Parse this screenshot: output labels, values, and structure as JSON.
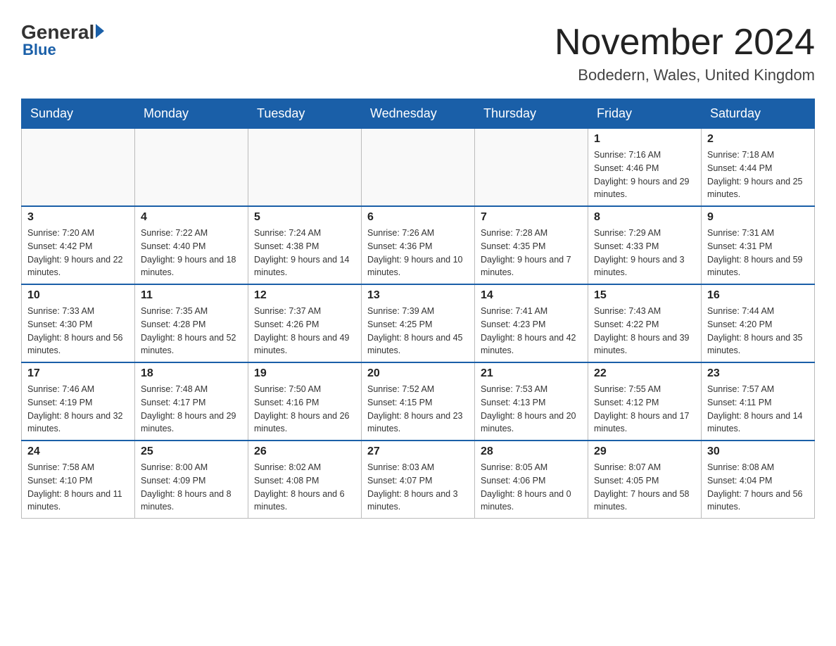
{
  "header": {
    "logo_general": "General",
    "logo_blue": "Blue",
    "title": "November 2024",
    "location": "Bodedern, Wales, United Kingdom"
  },
  "days_of_week": [
    "Sunday",
    "Monday",
    "Tuesday",
    "Wednesday",
    "Thursday",
    "Friday",
    "Saturday"
  ],
  "weeks": [
    [
      {
        "day": "",
        "info": ""
      },
      {
        "day": "",
        "info": ""
      },
      {
        "day": "",
        "info": ""
      },
      {
        "day": "",
        "info": ""
      },
      {
        "day": "",
        "info": ""
      },
      {
        "day": "1",
        "info": "Sunrise: 7:16 AM\nSunset: 4:46 PM\nDaylight: 9 hours and 29 minutes."
      },
      {
        "day": "2",
        "info": "Sunrise: 7:18 AM\nSunset: 4:44 PM\nDaylight: 9 hours and 25 minutes."
      }
    ],
    [
      {
        "day": "3",
        "info": "Sunrise: 7:20 AM\nSunset: 4:42 PM\nDaylight: 9 hours and 22 minutes."
      },
      {
        "day": "4",
        "info": "Sunrise: 7:22 AM\nSunset: 4:40 PM\nDaylight: 9 hours and 18 minutes."
      },
      {
        "day": "5",
        "info": "Sunrise: 7:24 AM\nSunset: 4:38 PM\nDaylight: 9 hours and 14 minutes."
      },
      {
        "day": "6",
        "info": "Sunrise: 7:26 AM\nSunset: 4:36 PM\nDaylight: 9 hours and 10 minutes."
      },
      {
        "day": "7",
        "info": "Sunrise: 7:28 AM\nSunset: 4:35 PM\nDaylight: 9 hours and 7 minutes."
      },
      {
        "day": "8",
        "info": "Sunrise: 7:29 AM\nSunset: 4:33 PM\nDaylight: 9 hours and 3 minutes."
      },
      {
        "day": "9",
        "info": "Sunrise: 7:31 AM\nSunset: 4:31 PM\nDaylight: 8 hours and 59 minutes."
      }
    ],
    [
      {
        "day": "10",
        "info": "Sunrise: 7:33 AM\nSunset: 4:30 PM\nDaylight: 8 hours and 56 minutes."
      },
      {
        "day": "11",
        "info": "Sunrise: 7:35 AM\nSunset: 4:28 PM\nDaylight: 8 hours and 52 minutes."
      },
      {
        "day": "12",
        "info": "Sunrise: 7:37 AM\nSunset: 4:26 PM\nDaylight: 8 hours and 49 minutes."
      },
      {
        "day": "13",
        "info": "Sunrise: 7:39 AM\nSunset: 4:25 PM\nDaylight: 8 hours and 45 minutes."
      },
      {
        "day": "14",
        "info": "Sunrise: 7:41 AM\nSunset: 4:23 PM\nDaylight: 8 hours and 42 minutes."
      },
      {
        "day": "15",
        "info": "Sunrise: 7:43 AM\nSunset: 4:22 PM\nDaylight: 8 hours and 39 minutes."
      },
      {
        "day": "16",
        "info": "Sunrise: 7:44 AM\nSunset: 4:20 PM\nDaylight: 8 hours and 35 minutes."
      }
    ],
    [
      {
        "day": "17",
        "info": "Sunrise: 7:46 AM\nSunset: 4:19 PM\nDaylight: 8 hours and 32 minutes."
      },
      {
        "day": "18",
        "info": "Sunrise: 7:48 AM\nSunset: 4:17 PM\nDaylight: 8 hours and 29 minutes."
      },
      {
        "day": "19",
        "info": "Sunrise: 7:50 AM\nSunset: 4:16 PM\nDaylight: 8 hours and 26 minutes."
      },
      {
        "day": "20",
        "info": "Sunrise: 7:52 AM\nSunset: 4:15 PM\nDaylight: 8 hours and 23 minutes."
      },
      {
        "day": "21",
        "info": "Sunrise: 7:53 AM\nSunset: 4:13 PM\nDaylight: 8 hours and 20 minutes."
      },
      {
        "day": "22",
        "info": "Sunrise: 7:55 AM\nSunset: 4:12 PM\nDaylight: 8 hours and 17 minutes."
      },
      {
        "day": "23",
        "info": "Sunrise: 7:57 AM\nSunset: 4:11 PM\nDaylight: 8 hours and 14 minutes."
      }
    ],
    [
      {
        "day": "24",
        "info": "Sunrise: 7:58 AM\nSunset: 4:10 PM\nDaylight: 8 hours and 11 minutes."
      },
      {
        "day": "25",
        "info": "Sunrise: 8:00 AM\nSunset: 4:09 PM\nDaylight: 8 hours and 8 minutes."
      },
      {
        "day": "26",
        "info": "Sunrise: 8:02 AM\nSunset: 4:08 PM\nDaylight: 8 hours and 6 minutes."
      },
      {
        "day": "27",
        "info": "Sunrise: 8:03 AM\nSunset: 4:07 PM\nDaylight: 8 hours and 3 minutes."
      },
      {
        "day": "28",
        "info": "Sunrise: 8:05 AM\nSunset: 4:06 PM\nDaylight: 8 hours and 0 minutes."
      },
      {
        "day": "29",
        "info": "Sunrise: 8:07 AM\nSunset: 4:05 PM\nDaylight: 7 hours and 58 minutes."
      },
      {
        "day": "30",
        "info": "Sunrise: 8:08 AM\nSunset: 4:04 PM\nDaylight: 7 hours and 56 minutes."
      }
    ]
  ]
}
